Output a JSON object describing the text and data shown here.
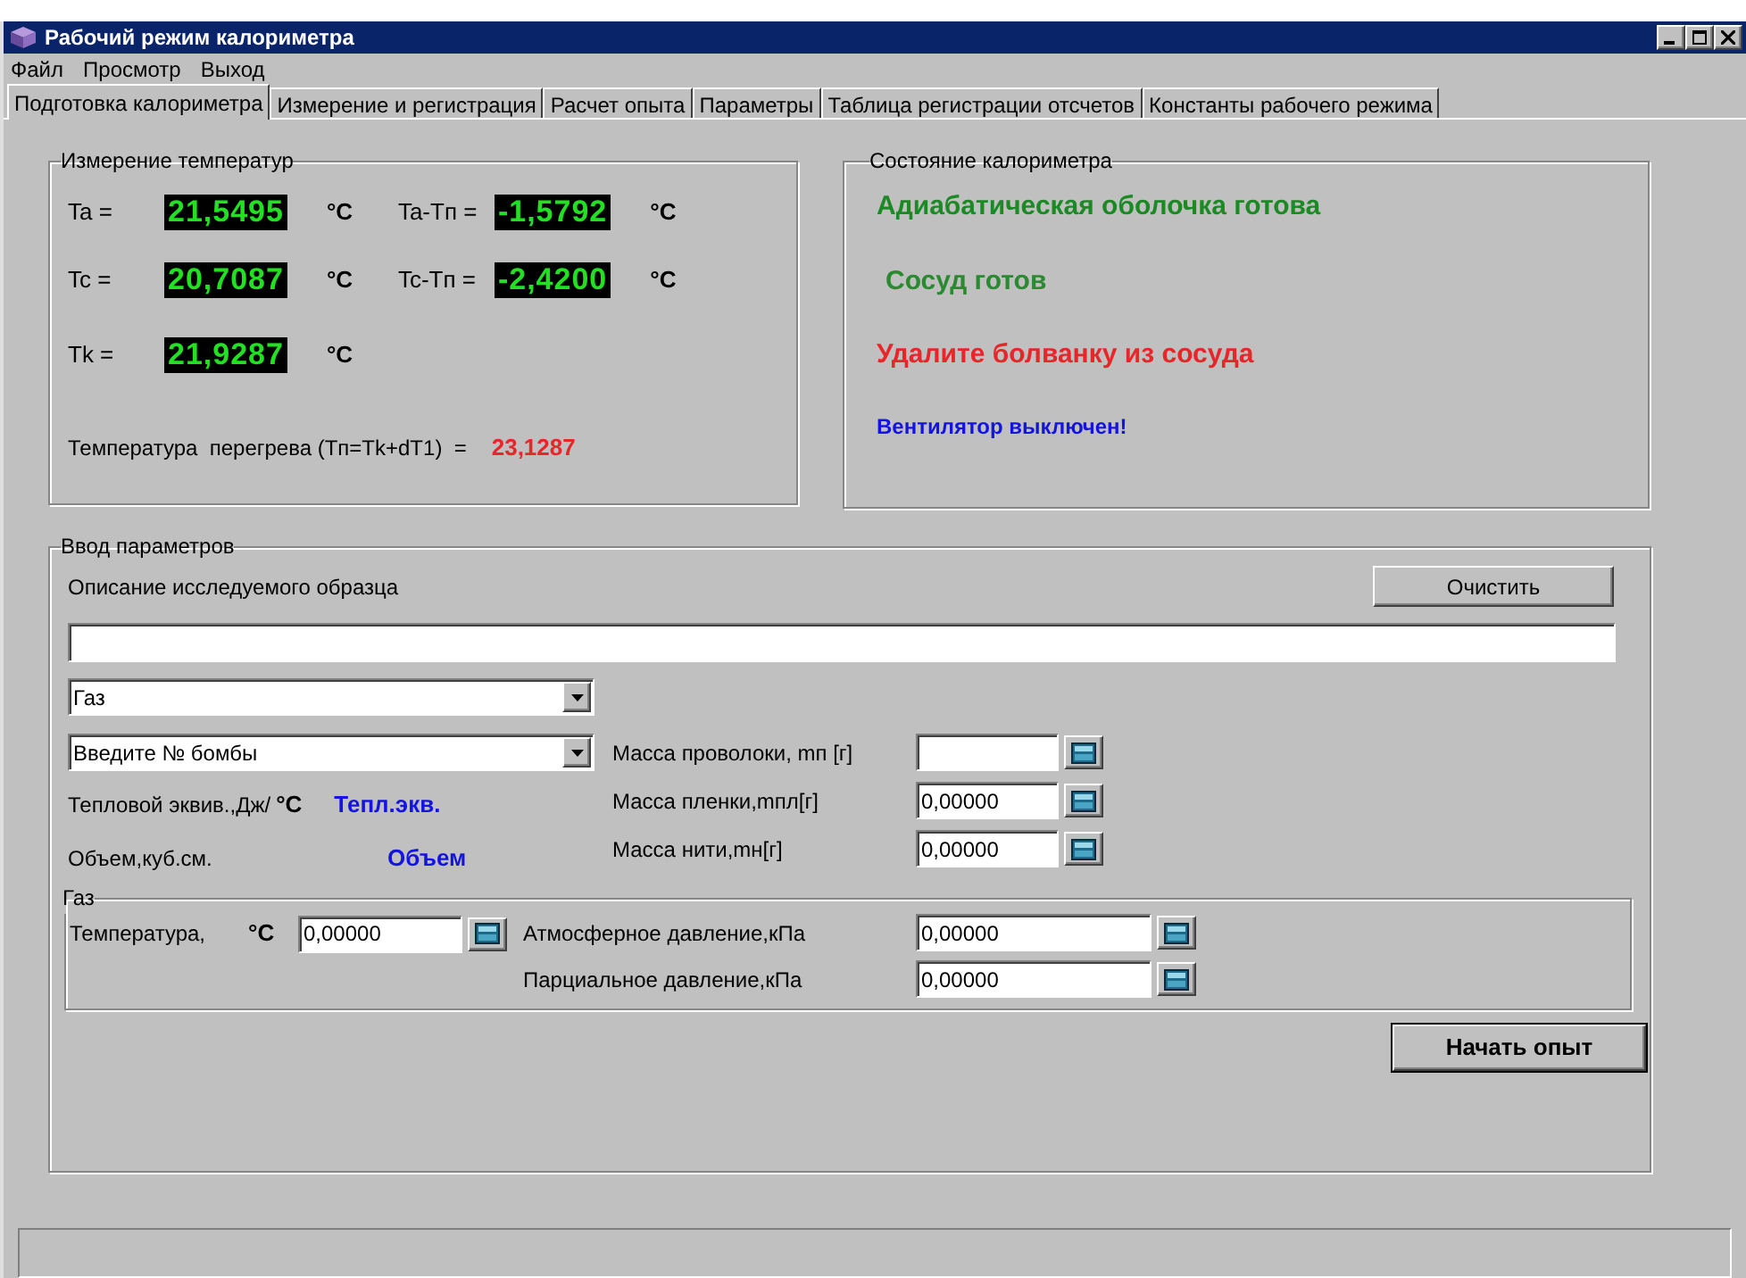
{
  "window": {
    "title": "Рабочий режим калориметра"
  },
  "menu": [
    "Файл",
    "Просмотр",
    "Выход"
  ],
  "tabs": [
    {
      "label": "Подготовка калориметра",
      "selected": true
    },
    {
      "label": "Измерение и регистрация",
      "selected": false
    },
    {
      "label": "Расчет опыта",
      "selected": false
    },
    {
      "label": "Параметры",
      "selected": false
    },
    {
      "label": "Таблица регистрации отсчетов",
      "selected": false
    },
    {
      "label": "Константы рабочего режима",
      "selected": false
    }
  ],
  "temperature_group": {
    "title": "Измерение температур",
    "rows": [
      [
        {
          "label": "Ta =",
          "value": "21,5495",
          "unit": "°C"
        },
        {
          "label": "Ta-Tп =",
          "value": "-1,5792",
          "unit": "°C"
        }
      ],
      [
        {
          "label": "Tc =",
          "value": "20,7087",
          "unit": "°C"
        },
        {
          "label": "Tc-Tп =",
          "value": "-2,4200",
          "unit": "°C"
        }
      ],
      [
        {
          "label": "Tk =",
          "value": "21,9287",
          "unit": "°C"
        }
      ]
    ],
    "overheat": {
      "label": "Температура  перегрева (Tп=Tk+dT1)  =",
      "value": "23,1287"
    }
  },
  "status_group": {
    "title": "Состояние калориметра",
    "messages": [
      {
        "text": "Адиабатическая оболочка готова",
        "color": "#1c8a24",
        "kind": "large"
      },
      {
        "text": "Сосуд готов",
        "color": "#2a8a30",
        "kind": "large"
      },
      {
        "text": "Удалите болванку из сосуда",
        "color": "#e8262a",
        "kind": "large"
      },
      {
        "text": "Вентилятор выключен!",
        "color": "#1414e0",
        "kind": "small"
      }
    ]
  },
  "params_group": {
    "title": "Ввод параметров",
    "description_label": "Описание исследуемого образца",
    "clear_button": "Очистить",
    "sample_type": {
      "value": "Газ"
    },
    "bomb": {
      "value": "Введите № бомбы"
    },
    "heat_equiv": {
      "label": "Тепловой эквив.,Дж/",
      "unit": "°C",
      "value": "Тепл.экв."
    },
    "volume": {
      "label": "Объем,куб.см.",
      "value": "Объем"
    },
    "masses": [
      {
        "label": "Масса проволоки, mп [г]"
      },
      {
        "label": "Масса пленки,mпл[г]",
        "value": "0,00000"
      },
      {
        "label": "Масса нити,mн[г]",
        "value": "0,00000"
      }
    ],
    "gas_group": {
      "title": "Газ",
      "temperature": {
        "label": "Температура,",
        "unit": "°C",
        "value": "0,00000"
      },
      "pressures": [
        {
          "label": "Атмосферное давление,кПа",
          "value": "0,00000"
        },
        {
          "label": "Парциальное давление,кПа",
          "value": "0,00000"
        }
      ]
    },
    "start_button": "Начать опыт"
  }
}
